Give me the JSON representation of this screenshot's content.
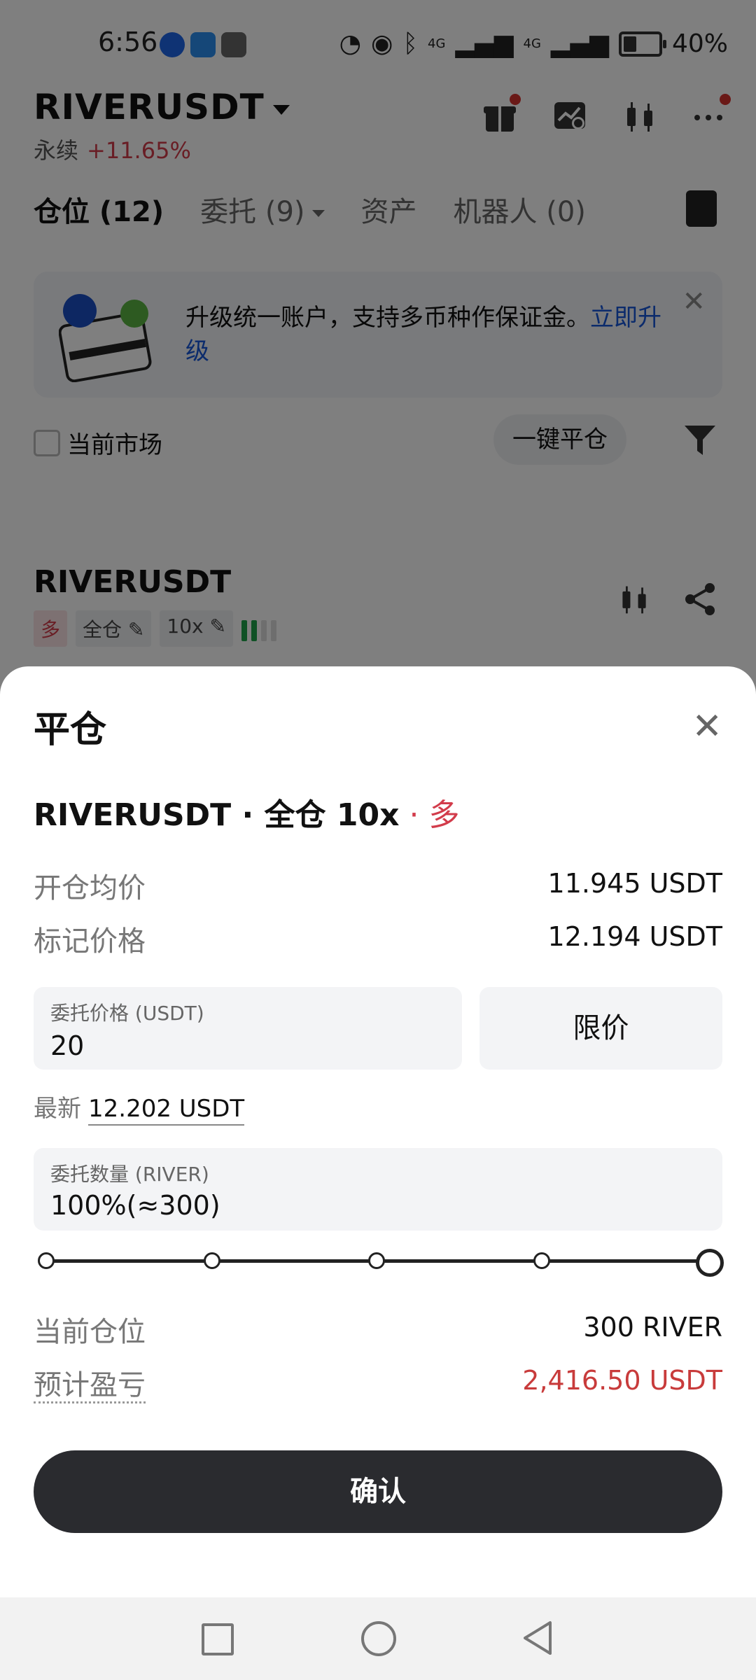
{
  "status_bar": {
    "time": "6:56",
    "network_1": "4G",
    "network_2": "4G",
    "battery": "40%"
  },
  "header": {
    "symbol": "RIVERUSDT",
    "type_label": "永续",
    "change": "+11.65%"
  },
  "tabs": [
    {
      "label": "仓位 (12)"
    },
    {
      "label": "委托 (9)"
    },
    {
      "label": "资产"
    },
    {
      "label": "机器人 (0)"
    }
  ],
  "banner": {
    "text": "升级统一账户，支持多币种作保证金。",
    "link": "立即升级",
    "close": "✕"
  },
  "filters": {
    "current_market": "当前市场",
    "close_all": "一键平仓"
  },
  "position": {
    "symbol": "RIVERUSDT",
    "direction_tag": "多",
    "margin_tag": "全仓",
    "leverage_tag": "10x"
  },
  "sheet": {
    "title": "平仓",
    "close": "✕",
    "subtitle_symbol": "RIVERUSDT",
    "subtitle_mode": " · 全仓 10x",
    "subtitle_dir": " · 多",
    "avg_open_label": "开仓均价",
    "avg_open_value": "11.945 USDT",
    "mark_label": "标记价格",
    "mark_value": "12.194 USDT",
    "order_price_label": "委托价格 (USDT)",
    "order_price_value": "20",
    "order_type": "限价",
    "latest_label": "最新",
    "latest_value": "12.202 USDT",
    "qty_label": "委托数量 (RIVER)",
    "qty_value": "100%(≈300)",
    "slider_percent": 100,
    "cur_pos_label": "当前仓位",
    "cur_pos_value": "300 RIVER",
    "est_pnl_label": "预计盈亏",
    "est_pnl_value": "2,416.50 USDT",
    "confirm": "确认"
  },
  "colors": {
    "long_red": "#d23c4b",
    "link_blue": "#1656d8",
    "confirm_bg": "#2a2b2f"
  }
}
